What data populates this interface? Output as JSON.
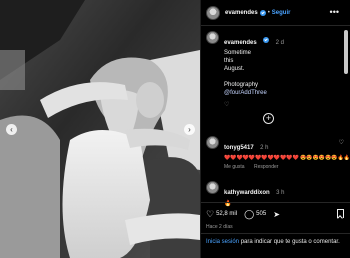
{
  "post": {
    "username": "evamendes",
    "follow_label": "Seguir",
    "separator": "•",
    "more": "•••"
  },
  "caption": {
    "username": "evamendes",
    "time": "2 d",
    "lines": [
      "Sometime",
      "this",
      "August."
    ],
    "photography_label": "Photography",
    "photographer": "@fourAddThree",
    "like_icon": "♡"
  },
  "load_more_icon": "+",
  "comments": [
    {
      "username": "tonyg5417",
      "time": "2 h",
      "text": "❤️❤️❤️❤️❤️❤️❤️❤️❤️❤️❤️❤️ 😍😍😍😍😍😍🔥🔥",
      "likes_label": "Me gusta",
      "reply_label": "Responder"
    },
    {
      "username": "kathywarddixon",
      "time": "3 h",
      "text": "🔥"
    }
  ],
  "actions": {
    "likes": "52,8 mil",
    "comments": "505"
  },
  "age": "Hace 2 días",
  "login": {
    "link": "Inicia sesión",
    "text": " para indicar que te gusta o comentar."
  },
  "colors": {
    "accent": "#4aa3ff",
    "background": "#000000",
    "verified": "#3897f0"
  }
}
